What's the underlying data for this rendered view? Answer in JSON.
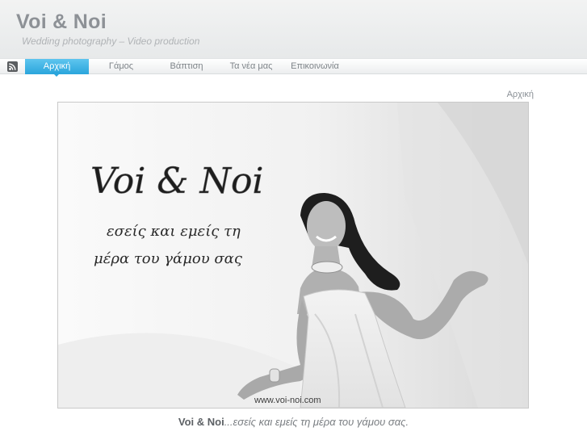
{
  "header": {
    "site_title": "Voi & Noi",
    "tagline": "Wedding photography – Video production"
  },
  "nav": {
    "rss_icon": "rss-icon",
    "items": [
      {
        "label": "Αρχική",
        "active": true
      },
      {
        "label": "Γάμος",
        "active": false
      },
      {
        "label": "Βάπτιση",
        "active": false
      },
      {
        "label": "Τα νέα μας",
        "active": false
      },
      {
        "label": "Επικοινωνία",
        "active": false
      }
    ]
  },
  "breadcrumb": "Αρχική",
  "hero": {
    "logo_text": "Voi & Noi",
    "script_line_1": "εσείς και εμείς τη",
    "script_line_2": "μέρα του γάμου σας",
    "watermark": "www.voi-noi.com"
  },
  "caption": {
    "brand": "Voi & Noi",
    "text": "...εσείς και εμείς τη μέρα του γάμου σας."
  },
  "colors": {
    "accent": "#2aa5dc",
    "title_gray": "#8d9196"
  }
}
